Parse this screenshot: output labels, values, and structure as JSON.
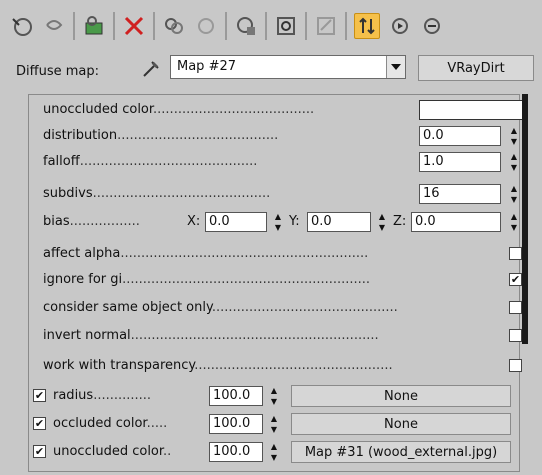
{
  "toolbar": {
    "icons": [
      "pick-material-icon",
      "put-to-scene-icon",
      "assign-to-selection-icon",
      "reset-map-icon",
      "make-unique-icon",
      "put-to-library-icon",
      "material-id-icon",
      "show-map-icon",
      "show-end-result-icon",
      "go-to-parent-icon",
      "go-forward-icon"
    ]
  },
  "header": {
    "diffuse_label": "Diffuse map:",
    "map_name": "Map #27",
    "map_type": "VRayDirt"
  },
  "params": {
    "unoccluded_color": {
      "label": "unoccluded color",
      "dots": "......................................."
    },
    "distribution": {
      "label": "distribution",
      "dots": ".......................................",
      "value": "0.0"
    },
    "falloff": {
      "label": "falloff",
      "dots": "...........................................",
      "value": "1.0"
    },
    "subdivs": {
      "label": "subdivs",
      "dots": "...........................................",
      "value": "16"
    },
    "bias": {
      "label": "bias",
      "dots": ".................",
      "x_label": "X:",
      "x": "0.0",
      "y_label": "Y:",
      "y": "0.0",
      "z_label": "Z:",
      "z": "0.0"
    },
    "affect_alpha": {
      "label": "affect alpha",
      "dots": "............................................................"
    },
    "ignore_gi": {
      "label": "ignore for gi",
      "dots": "............................................................",
      "checked": "✔"
    },
    "consider_same": {
      "label": "consider same object only",
      "dots": "............................................."
    },
    "invert_normal": {
      "label": "invert normal",
      "dots": "............................................................"
    },
    "work_transp": {
      "label": "work with transparency",
      "dots": "................................................"
    }
  },
  "maps": [
    {
      "label": "radius",
      "dots": "..............",
      "value": "100.0",
      "map": "None",
      "checked": "✔"
    },
    {
      "label": "occluded color",
      "dots": ".....",
      "value": "100.0",
      "map": "None",
      "checked": "✔"
    },
    {
      "label": "unoccluded color",
      "dots": "..",
      "value": "100.0",
      "map": "Map #31 (wood_external.jpg)",
      "checked": "✔"
    }
  ]
}
